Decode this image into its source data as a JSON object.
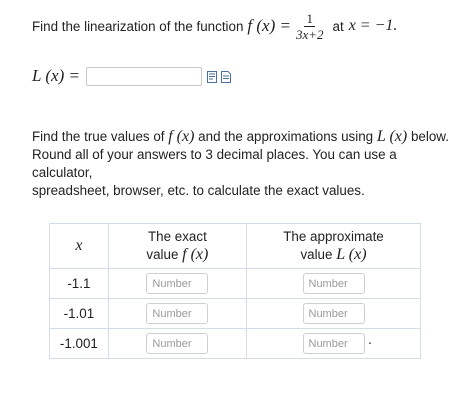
{
  "question1": {
    "text": "Find the linearization of the function",
    "function_lhs": "f (x) =",
    "numerator": "1",
    "denominator": "3x+2",
    "at_text": "at",
    "point": "x = −1."
  },
  "answer": {
    "label": "L (x) =",
    "value": ""
  },
  "question2": {
    "line1_a": "Find the true values of",
    "line1_f": "f (x)",
    "line1_b": "and the approximations using",
    "line1_L": "L (x)",
    "line1_c": "below.",
    "line2": "Round all of your answers to 3 decimal places. You can use a calculator,",
    "line3": "spreadsheet, browser, etc. to calculate the exact values."
  },
  "table": {
    "header_x": "x",
    "header_exact_line1": "The exact",
    "header_exact_line2": "value",
    "header_exact_fn": "f (x)",
    "header_approx_line1": "The approximate",
    "header_approx_line2": "value",
    "header_approx_fn": "L (x)",
    "input_placeholder": "Number",
    "rows": [
      {
        "x": "-1.1",
        "exact": "",
        "approx": ""
      },
      {
        "x": "-1.01",
        "exact": "",
        "approx": ""
      },
      {
        "x": "-1.001",
        "exact": "",
        "approx": ""
      }
    ],
    "trailing_punct": "."
  },
  "icons": {
    "tool1": "equation-editor-icon",
    "tool2": "help-document-icon"
  }
}
